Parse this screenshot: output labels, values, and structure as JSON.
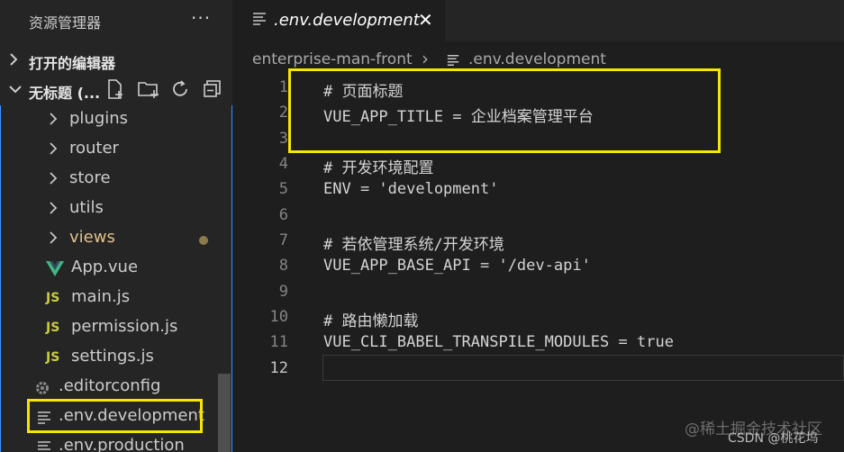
{
  "sidebar": {
    "title": "资源管理器",
    "more": "···",
    "open_editors": "打开的编辑器",
    "workspace": "无标题 (...",
    "items": [
      {
        "label": "plugins",
        "type": "folder"
      },
      {
        "label": "router",
        "type": "folder"
      },
      {
        "label": "store",
        "type": "folder"
      },
      {
        "label": "utils",
        "type": "folder"
      },
      {
        "label": "views",
        "type": "folder"
      },
      {
        "label": "App.vue",
        "type": "vue"
      },
      {
        "label": "main.js",
        "type": "js"
      },
      {
        "label": "permission.js",
        "type": "js"
      },
      {
        "label": "settings.js",
        "type": "js"
      },
      {
        "label": ".editorconfig",
        "type": "gear"
      },
      {
        "label": ".env.development",
        "type": "lines"
      },
      {
        "label": ".env.production",
        "type": "lines"
      }
    ],
    "js_badge": "JS"
  },
  "tab": {
    "label": ".env.development",
    "close": "✕"
  },
  "breadcrumb": {
    "folder": "enterprise-man-front",
    "separator": "›",
    "file": ".env.development"
  },
  "code": [
    {
      "n": "1",
      "text": "# 页面标题"
    },
    {
      "n": "2",
      "text": "VUE_APP_TITLE = 企业档案管理平台"
    },
    {
      "n": "3",
      "text": ""
    },
    {
      "n": "4",
      "text": "# 开发环境配置"
    },
    {
      "n": "5",
      "text": "ENV = 'development'"
    },
    {
      "n": "6",
      "text": ""
    },
    {
      "n": "7",
      "text": "# 若依管理系统/开发环境"
    },
    {
      "n": "8",
      "text": "VUE_APP_BASE_API = '/dev-api'"
    },
    {
      "n": "9",
      "text": ""
    },
    {
      "n": "10",
      "text": "# 路由懒加载"
    },
    {
      "n": "11",
      "text": "VUE_CLI_BABEL_TRANSPILE_MODULES = true"
    },
    {
      "n": "12",
      "text": ""
    }
  ],
  "watermark": "@稀土掘金技术社区",
  "watermark2": "CSDN @桃花坞",
  "colors": {
    "highlight": "#f7e600",
    "views_label": "#e2c08d",
    "js_badge": "#cbcb41",
    "vue_icon": "#41b883"
  }
}
